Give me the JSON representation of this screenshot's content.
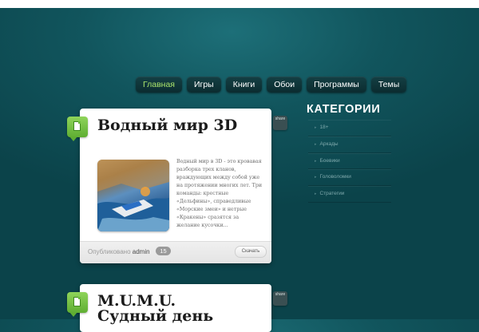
{
  "nav": {
    "items": [
      {
        "label": "Главная",
        "active": true
      },
      {
        "label": "Игры"
      },
      {
        "label": "Книги"
      },
      {
        "label": "Обои"
      },
      {
        "label": "Программы"
      },
      {
        "label": "Темы"
      }
    ]
  },
  "posts": [
    {
      "title": "Водный мир 3D",
      "excerpt": "Водный мир в 3D - это кровавая разборка трех кланов, враждующих между собой уже на протяжении многих лет. Три команды: крестные «Дельфины», справедливые «Морские змеи» и нетрые «Кракены» сразятся за желание кусочки...",
      "posted_label": "Опубликовано",
      "author": "admin",
      "comments": "15",
      "download_label": "Скачать",
      "share_label": "share"
    },
    {
      "title": "M.U.M.U. Судный день",
      "share_label": "share"
    }
  ],
  "sidebar": {
    "title": "КАТЕГОРИИ",
    "categories": [
      {
        "label": "18+"
      },
      {
        "label": "Аркады"
      },
      {
        "label": "Боевики"
      },
      {
        "label": "Головоломки"
      },
      {
        "label": "Стратегии"
      }
    ]
  },
  "colors": {
    "background": "#0d4a52",
    "accent_green": "#a9e36b",
    "card": "#ffffff"
  }
}
